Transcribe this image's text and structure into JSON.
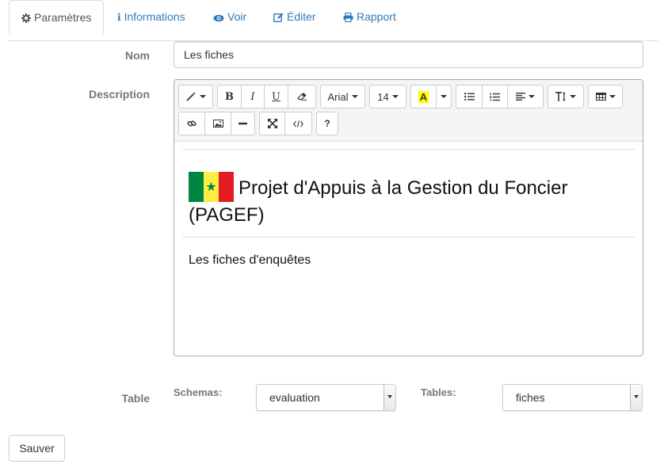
{
  "tabs": [
    {
      "label": "Paramètres",
      "icon": "gear-icon",
      "active": true
    },
    {
      "label": "Informations",
      "icon": "info-icon"
    },
    {
      "label": "Voir",
      "icon": "eye-icon"
    },
    {
      "label": "Éditer",
      "icon": "edit-icon"
    },
    {
      "label": "Rapport",
      "icon": "print-icon"
    }
  ],
  "form": {
    "nom_label": "Nom",
    "nom_value": "Les fiches",
    "description_label": "Description",
    "table_label": "Table",
    "schemas_label": "Schemas:",
    "schemas_value": "evaluation",
    "tables_label": "Tables:",
    "tables_value": "fiches",
    "save_label": "Sauver"
  },
  "editor": {
    "toolbar": {
      "font_name": "Arial",
      "font_size": "14",
      "bold": "B",
      "italic": "I",
      "underline": "U",
      "highlight": "A",
      "help": "?"
    },
    "heading": "Projet d'Appuis à la Gestion du Foncier (PAGEF)",
    "body": "Les fiches d'enquêtes",
    "flag_colors": [
      "#00853f",
      "#fdef42",
      "#e31b23"
    ]
  },
  "colors": {
    "link": "#337ab7",
    "highlight_bg": "#ffff00"
  }
}
